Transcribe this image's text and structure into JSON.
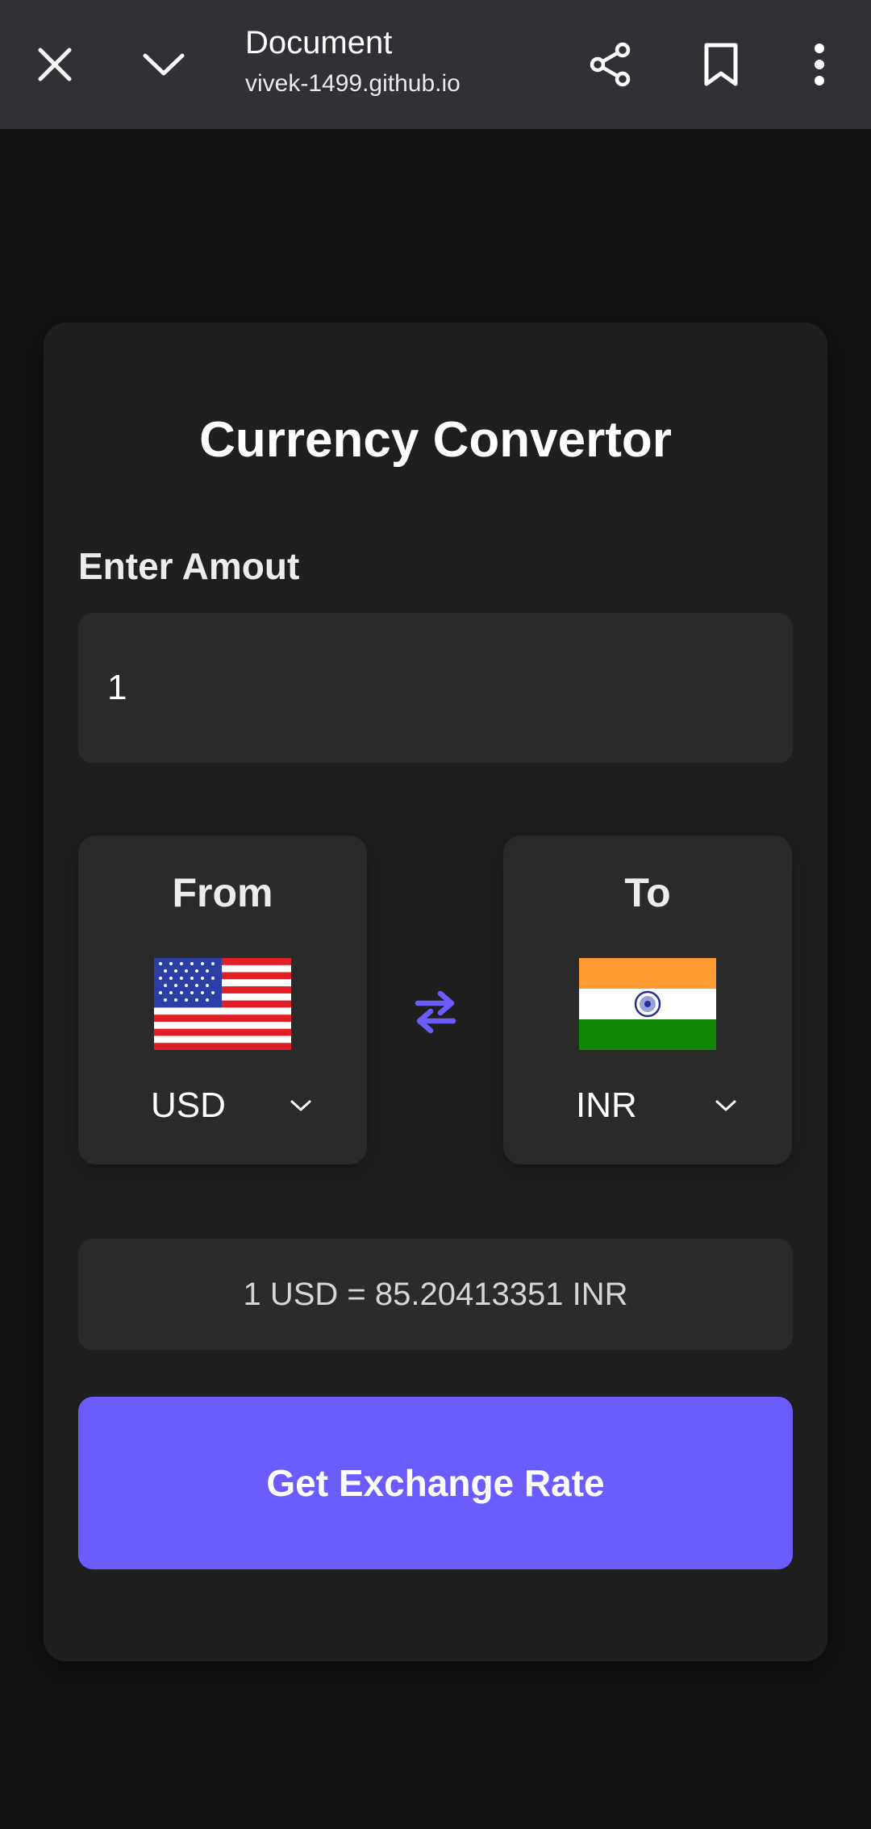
{
  "browser": {
    "title": "Document",
    "url": "vivek-1499.github.io",
    "icons": [
      "close-icon",
      "chevron-down-icon",
      "share-icon",
      "bookmark-icon",
      "more-vert-icon"
    ]
  },
  "app": {
    "title": "Currency Convertor",
    "amount_label": "Enter Amout",
    "amount_value": "1",
    "from": {
      "label": "From",
      "currency": "USD",
      "flag": "us-flag"
    },
    "to": {
      "label": "To",
      "currency": "INR",
      "flag": "india-flag"
    },
    "result_text": "1 USD = 85.20413351 INR",
    "button_label": "Get Exchange Rate"
  },
  "colors": {
    "background": "#121212",
    "card": "#1f1f20",
    "accent": "#6a5cff",
    "topbar": "#303134"
  }
}
